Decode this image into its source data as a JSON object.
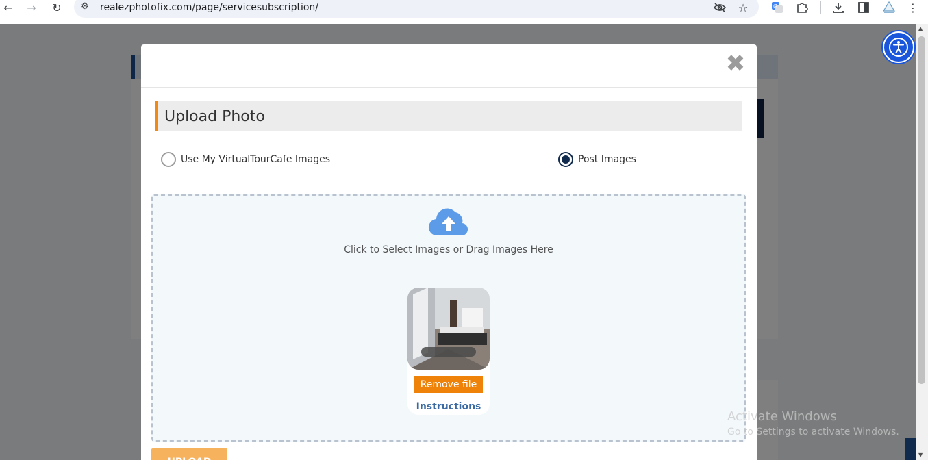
{
  "browser": {
    "url": "realezphotofix.com/page/servicesubscription/",
    "icons": [
      "back-icon",
      "forward-icon",
      "reload-icon",
      "site-settings-icon",
      "eye-off-icon",
      "star-icon",
      "translate-icon",
      "extensions-icon",
      "download-icon",
      "side-panel-icon",
      "profile-extension-icon",
      "menu-icon"
    ]
  },
  "modal": {
    "close_label": "✖",
    "title": "Upload Photo",
    "radio_options": [
      {
        "label": "Use My VirtualTourCafe Images",
        "checked": false
      },
      {
        "label": "Post Images",
        "checked": true
      }
    ],
    "dropzone_text": "Click to Select Images or Drag Images Here",
    "preview": {
      "remove_label": "Remove file",
      "instructions_label": "Instructions"
    },
    "upload_label": "UPLOAD"
  },
  "watermark": {
    "title": "Activate Windows",
    "subtitle": "Go to Settings to activate Windows."
  },
  "colors": {
    "accent_orange": "#ef8208",
    "title_border": "#ef8a17",
    "radio_checked": "#0f2a4d",
    "link_blue": "#3b6aa3",
    "cloud_blue": "#5b9be8",
    "a11y_blue": "#1a56db"
  }
}
